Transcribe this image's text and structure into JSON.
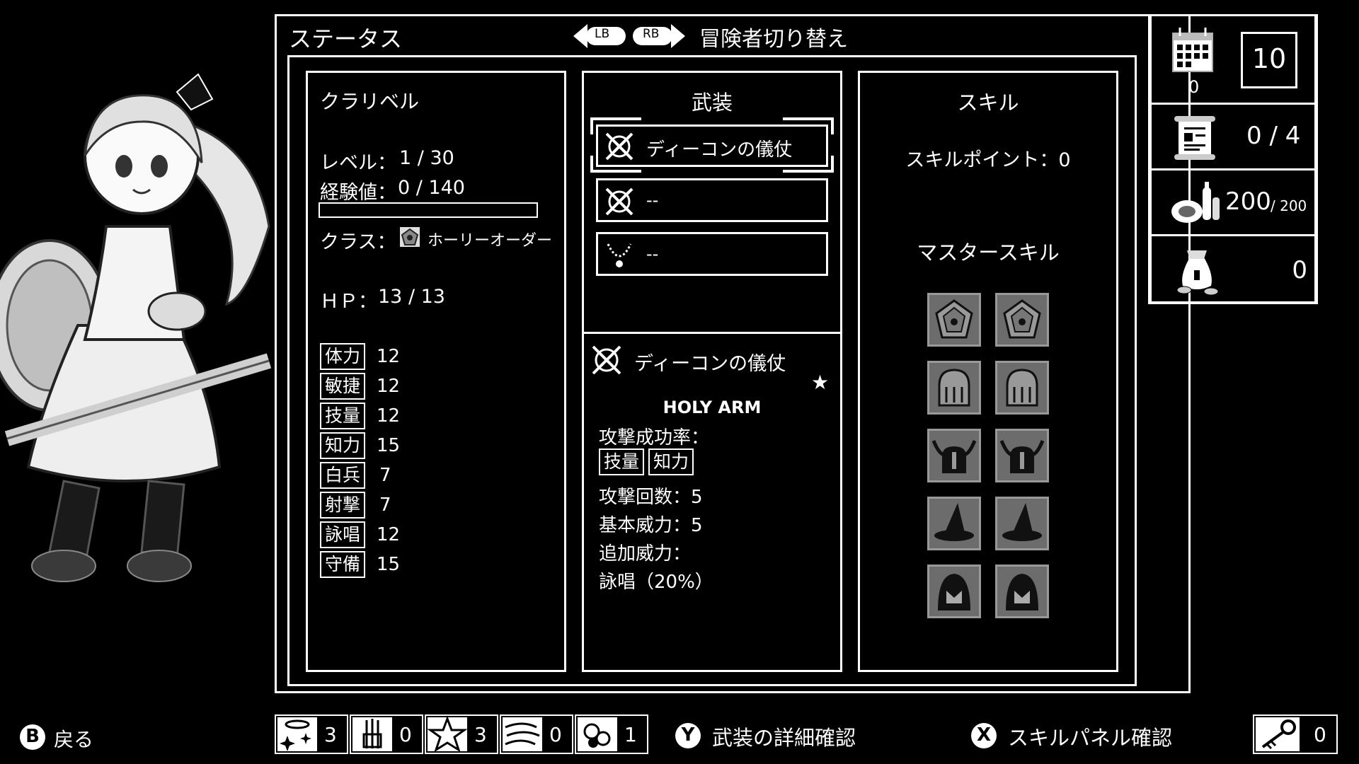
{
  "header": {
    "title": "ステータス",
    "lb": "LB",
    "rb": "RB",
    "switch_label": "冒険者切り替え"
  },
  "character": {
    "name": "クラリベル",
    "level_label": "レベル：",
    "level_value": "1 / 30",
    "exp_label": "経験値：",
    "exp_value": "0 / 140",
    "exp_progress": 0.0,
    "class_label": "クラス：",
    "class_name": "ホーリーオーダー",
    "hp_label": "ＨＰ：",
    "hp_value": "13 / 13",
    "stats": [
      {
        "label": "体力",
        "value": "12"
      },
      {
        "label": "敏捷",
        "value": "12"
      },
      {
        "label": "技量",
        "value": "12"
      },
      {
        "label": "知力",
        "value": "15"
      },
      {
        "label": "白兵",
        "value": "7"
      },
      {
        "label": "射撃",
        "value": "7"
      },
      {
        "label": "詠唱",
        "value": "12"
      },
      {
        "label": "守備",
        "value": "15"
      }
    ]
  },
  "equipment": {
    "title": "武装",
    "slots": [
      {
        "icon": "crossed-weapons-icon",
        "label": "ディーコンの儀仗"
      },
      {
        "icon": "crossed-weapons-icon",
        "label": "--"
      },
      {
        "icon": "necklace-icon",
        "label": "--"
      }
    ],
    "detail": {
      "name": "ディーコンの儀仗",
      "star": "★",
      "type": "HOLY ARM",
      "hit_rate_label": "攻撃成功率：",
      "hit_stats": [
        "技量",
        "知力"
      ],
      "attack_count": "攻撃回数：5",
      "base_power": "基本威力：5",
      "extra_power_label": "追加威力：",
      "extra_power_value": "詠唱（20%）"
    }
  },
  "skills": {
    "title": "スキル",
    "points": "スキルポイント：0",
    "master_title": "マスタースキル",
    "tiles": [
      "pentagon-emblem-icon",
      "pentagon-emblem-icon",
      "knight-helmet-icon",
      "knight-helmet-icon",
      "horned-helmet-icon",
      "horned-helmet-icon",
      "witch-hat-icon",
      "witch-hat-icon",
      "hooded-figure-icon",
      "hooded-figure-icon"
    ]
  },
  "resources": {
    "calendar_sub": "0",
    "day": "10",
    "quests": "0 / 4",
    "food_main": "200",
    "food_max": "/ 200",
    "gold": "0"
  },
  "footer": {
    "back_btn": "B",
    "back_label": "戻る",
    "items": [
      {
        "icon": "halo-sparkle-icon",
        "count": "3"
      },
      {
        "icon": "arrow-bundle-icon",
        "count": "0"
      },
      {
        "icon": "star-burst-icon",
        "count": "3"
      },
      {
        "icon": "wind-swirl-icon",
        "count": "0"
      },
      {
        "icon": "orb-cluster-icon",
        "count": "1"
      }
    ],
    "y_btn": "Y",
    "y_label": "武装の詳細確認",
    "x_btn": "X",
    "x_label": "スキルパネル確認",
    "key_count": "0"
  }
}
